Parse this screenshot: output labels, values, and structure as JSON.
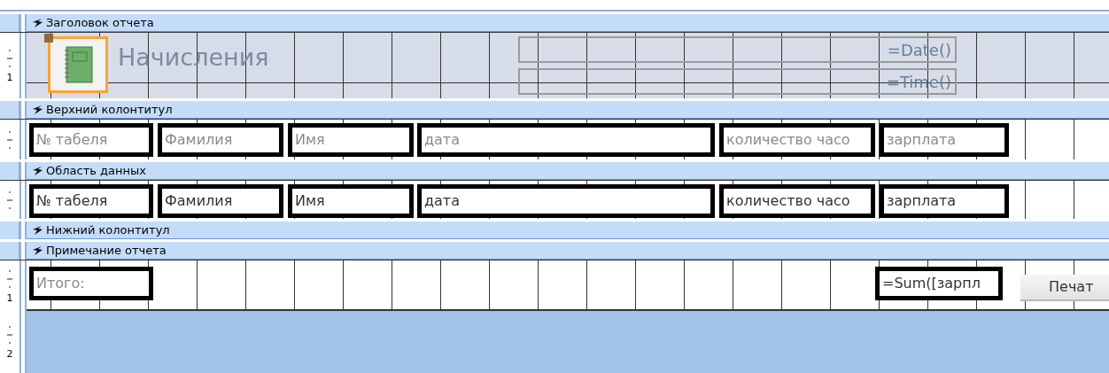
{
  "sections": [
    {
      "kind": "report_header",
      "title": "Заголовок отчета",
      "ruler_label": "1",
      "controls": [
        {
          "kind": "logo",
          "selected": true
        },
        {
          "kind": "title",
          "text": "Начисления"
        },
        {
          "kind": "formula",
          "text": "=Date()"
        },
        {
          "kind": "formula",
          "text": "=Time()"
        }
      ]
    },
    {
      "kind": "page_header",
      "title": "Верхний колонтитул",
      "controls": [
        {
          "kind": "label",
          "text": "№ табеля"
        },
        {
          "kind": "label",
          "text": "Фамилия"
        },
        {
          "kind": "label",
          "text": "Имя"
        },
        {
          "kind": "label",
          "text": "дата"
        },
        {
          "kind": "label",
          "text": "количество часо"
        },
        {
          "kind": "label",
          "text": "зарплата"
        }
      ]
    },
    {
      "kind": "detail",
      "title": "Область данных",
      "controls": [
        {
          "kind": "textbox",
          "text": "№ табеля"
        },
        {
          "kind": "textbox",
          "text": "Фамилия"
        },
        {
          "kind": "textbox",
          "text": "Имя"
        },
        {
          "kind": "textbox",
          "text": "дата"
        },
        {
          "kind": "textbox",
          "text": "количество часо"
        },
        {
          "kind": "textbox",
          "text": "зарплата"
        }
      ]
    },
    {
      "kind": "page_footer",
      "title": "Нижний колонтитул"
    },
    {
      "kind": "report_footer",
      "title": "Примечание отчета",
      "ruler_label": "1",
      "controls": [
        {
          "kind": "label",
          "text": "Итого:"
        },
        {
          "kind": "textbox",
          "text": "=Sum([зарпл"
        },
        {
          "kind": "button",
          "text": "Печат"
        }
      ]
    }
  ],
  "bottom_ruler_label": "2"
}
